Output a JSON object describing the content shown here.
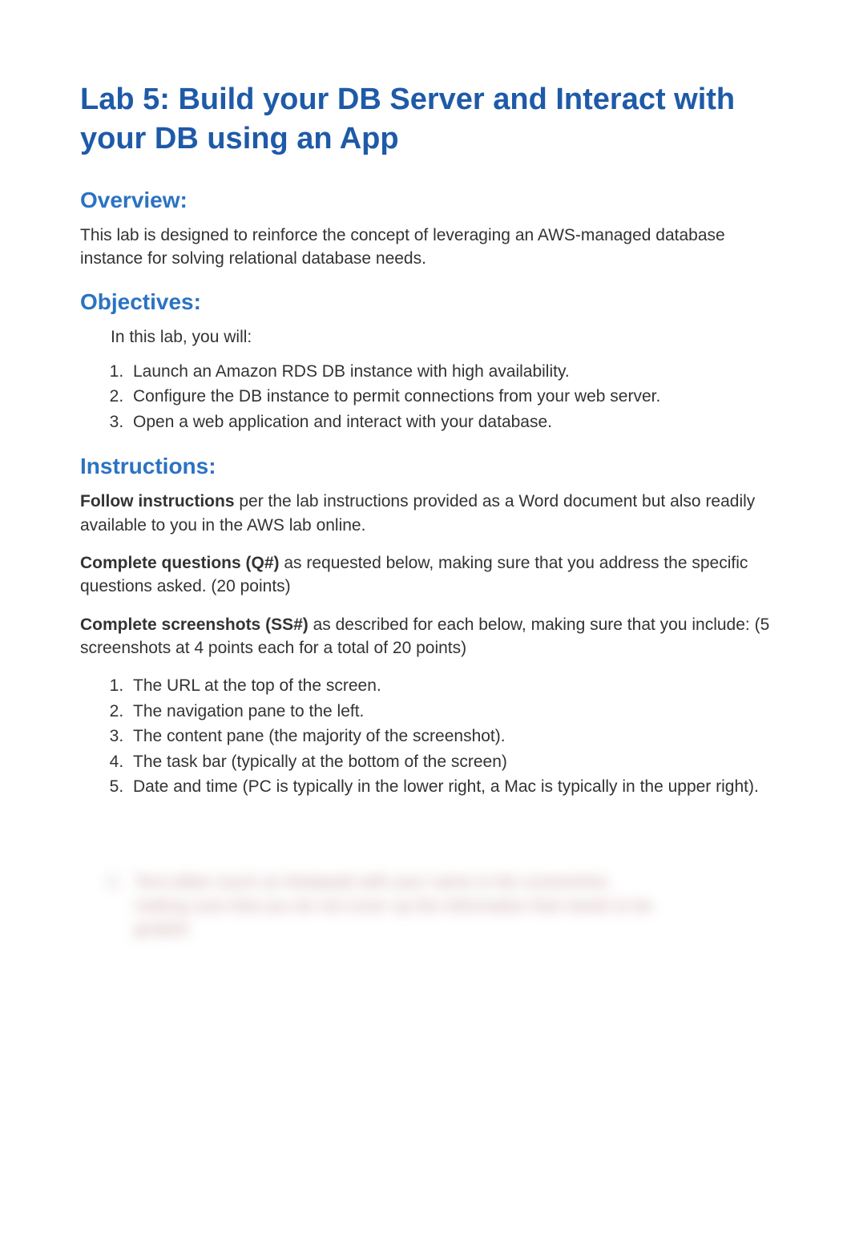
{
  "title": "Lab 5: Build your DB Server and Interact with your DB using an App",
  "sections": {
    "overview": {
      "heading": "Overview:",
      "text": "This lab is designed to reinforce the concept of leveraging an AWS-managed database instance for solving relational database needs."
    },
    "objectives": {
      "heading": "Objectives:",
      "intro": "In this lab, you will:",
      "items": [
        "Launch an Amazon RDS DB instance with high availability.",
        "Configure the DB instance to permit connections from your web server.",
        "Open a web application and interact with your database."
      ]
    },
    "instructions": {
      "heading": "Instructions:",
      "p1_bold": "Follow instructions",
      "p1_rest": " per the lab instructions provided as a Word document but also readily available to you in the AWS lab online.",
      "p2_bold": "Complete questions (Q#)",
      "p2_rest": " as requested below, making sure that you address the specific questions asked. (20 points)",
      "p3_bold": "Complete screenshots (SS#)",
      "p3_rest": " as described for each below, making sure that you include: (5 screenshots at 4 points each for a total of 20 points)",
      "items": [
        "The URL at the top of the screen.",
        "The navigation pane to the left.",
        "The content pane (the majority of the screenshot).",
        "The task bar (typically at the bottom of the screen)",
        "Date and time (PC is typically in the lower right, a Mac is typically in the upper right)."
      ]
    },
    "blurred": {
      "marker": "6.",
      "line1": "Text editor (such as Notepad) with your name in the screenshot,",
      "line2": "making sure that you do not cover up the information that needs to be",
      "line3": "graded."
    }
  }
}
